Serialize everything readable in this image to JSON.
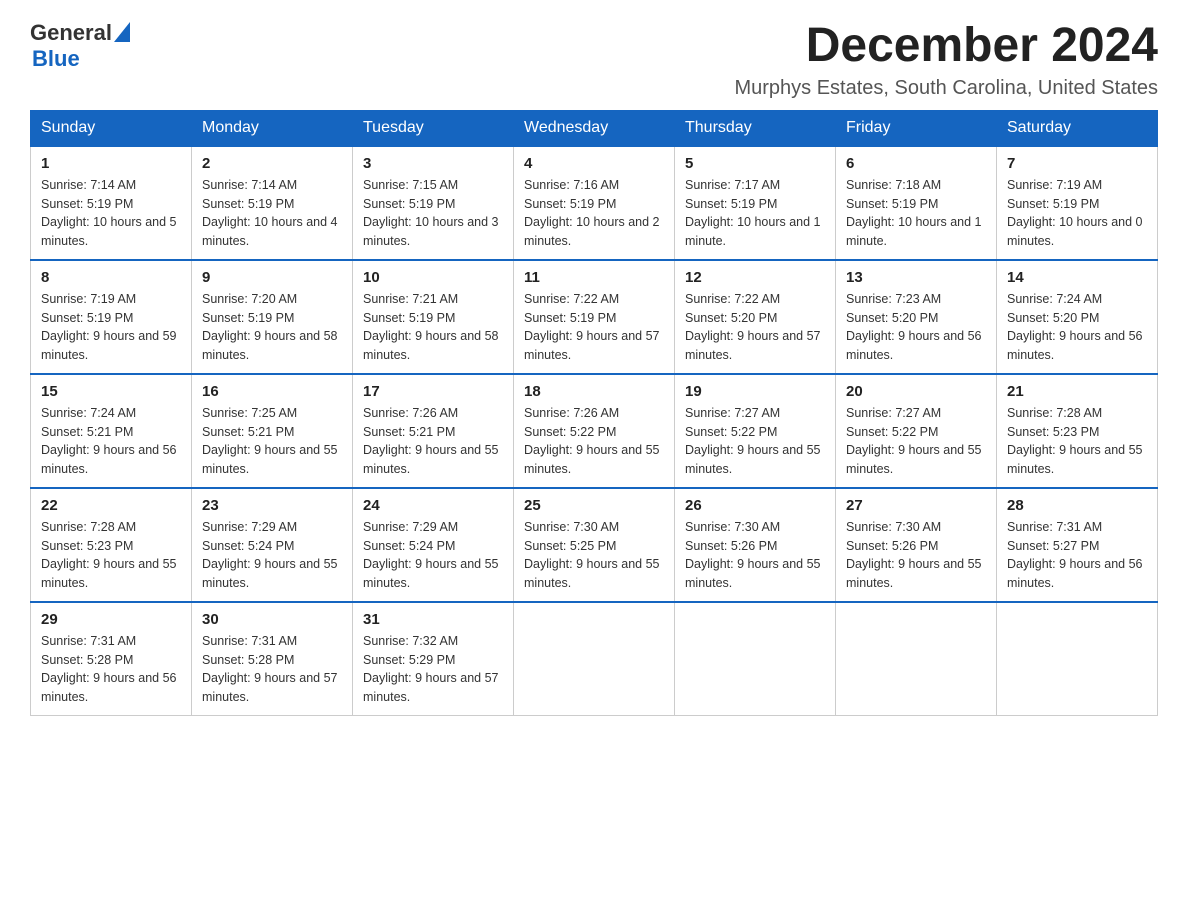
{
  "header": {
    "logo_general": "General",
    "logo_blue": "Blue",
    "month_title": "December 2024",
    "location": "Murphys Estates, South Carolina, United States"
  },
  "days_of_week": [
    "Sunday",
    "Monday",
    "Tuesday",
    "Wednesday",
    "Thursday",
    "Friday",
    "Saturday"
  ],
  "weeks": [
    [
      {
        "day": "1",
        "sunrise": "7:14 AM",
        "sunset": "5:19 PM",
        "daylight": "10 hours and 5 minutes."
      },
      {
        "day": "2",
        "sunrise": "7:14 AM",
        "sunset": "5:19 PM",
        "daylight": "10 hours and 4 minutes."
      },
      {
        "day": "3",
        "sunrise": "7:15 AM",
        "sunset": "5:19 PM",
        "daylight": "10 hours and 3 minutes."
      },
      {
        "day": "4",
        "sunrise": "7:16 AM",
        "sunset": "5:19 PM",
        "daylight": "10 hours and 2 minutes."
      },
      {
        "day": "5",
        "sunrise": "7:17 AM",
        "sunset": "5:19 PM",
        "daylight": "10 hours and 1 minute."
      },
      {
        "day": "6",
        "sunrise": "7:18 AM",
        "sunset": "5:19 PM",
        "daylight": "10 hours and 1 minute."
      },
      {
        "day": "7",
        "sunrise": "7:19 AM",
        "sunset": "5:19 PM",
        "daylight": "10 hours and 0 minutes."
      }
    ],
    [
      {
        "day": "8",
        "sunrise": "7:19 AM",
        "sunset": "5:19 PM",
        "daylight": "9 hours and 59 minutes."
      },
      {
        "day": "9",
        "sunrise": "7:20 AM",
        "sunset": "5:19 PM",
        "daylight": "9 hours and 58 minutes."
      },
      {
        "day": "10",
        "sunrise": "7:21 AM",
        "sunset": "5:19 PM",
        "daylight": "9 hours and 58 minutes."
      },
      {
        "day": "11",
        "sunrise": "7:22 AM",
        "sunset": "5:19 PM",
        "daylight": "9 hours and 57 minutes."
      },
      {
        "day": "12",
        "sunrise": "7:22 AM",
        "sunset": "5:20 PM",
        "daylight": "9 hours and 57 minutes."
      },
      {
        "day": "13",
        "sunrise": "7:23 AM",
        "sunset": "5:20 PM",
        "daylight": "9 hours and 56 minutes."
      },
      {
        "day": "14",
        "sunrise": "7:24 AM",
        "sunset": "5:20 PM",
        "daylight": "9 hours and 56 minutes."
      }
    ],
    [
      {
        "day": "15",
        "sunrise": "7:24 AM",
        "sunset": "5:21 PM",
        "daylight": "9 hours and 56 minutes."
      },
      {
        "day": "16",
        "sunrise": "7:25 AM",
        "sunset": "5:21 PM",
        "daylight": "9 hours and 55 minutes."
      },
      {
        "day": "17",
        "sunrise": "7:26 AM",
        "sunset": "5:21 PM",
        "daylight": "9 hours and 55 minutes."
      },
      {
        "day": "18",
        "sunrise": "7:26 AM",
        "sunset": "5:22 PM",
        "daylight": "9 hours and 55 minutes."
      },
      {
        "day": "19",
        "sunrise": "7:27 AM",
        "sunset": "5:22 PM",
        "daylight": "9 hours and 55 minutes."
      },
      {
        "day": "20",
        "sunrise": "7:27 AM",
        "sunset": "5:22 PM",
        "daylight": "9 hours and 55 minutes."
      },
      {
        "day": "21",
        "sunrise": "7:28 AM",
        "sunset": "5:23 PM",
        "daylight": "9 hours and 55 minutes."
      }
    ],
    [
      {
        "day": "22",
        "sunrise": "7:28 AM",
        "sunset": "5:23 PM",
        "daylight": "9 hours and 55 minutes."
      },
      {
        "day": "23",
        "sunrise": "7:29 AM",
        "sunset": "5:24 PM",
        "daylight": "9 hours and 55 minutes."
      },
      {
        "day": "24",
        "sunrise": "7:29 AM",
        "sunset": "5:24 PM",
        "daylight": "9 hours and 55 minutes."
      },
      {
        "day": "25",
        "sunrise": "7:30 AM",
        "sunset": "5:25 PM",
        "daylight": "9 hours and 55 minutes."
      },
      {
        "day": "26",
        "sunrise": "7:30 AM",
        "sunset": "5:26 PM",
        "daylight": "9 hours and 55 minutes."
      },
      {
        "day": "27",
        "sunrise": "7:30 AM",
        "sunset": "5:26 PM",
        "daylight": "9 hours and 55 minutes."
      },
      {
        "day": "28",
        "sunrise": "7:31 AM",
        "sunset": "5:27 PM",
        "daylight": "9 hours and 56 minutes."
      }
    ],
    [
      {
        "day": "29",
        "sunrise": "7:31 AM",
        "sunset": "5:28 PM",
        "daylight": "9 hours and 56 minutes."
      },
      {
        "day": "30",
        "sunrise": "7:31 AM",
        "sunset": "5:28 PM",
        "daylight": "9 hours and 57 minutes."
      },
      {
        "day": "31",
        "sunrise": "7:32 AM",
        "sunset": "5:29 PM",
        "daylight": "9 hours and 57 minutes."
      },
      null,
      null,
      null,
      null
    ]
  ]
}
